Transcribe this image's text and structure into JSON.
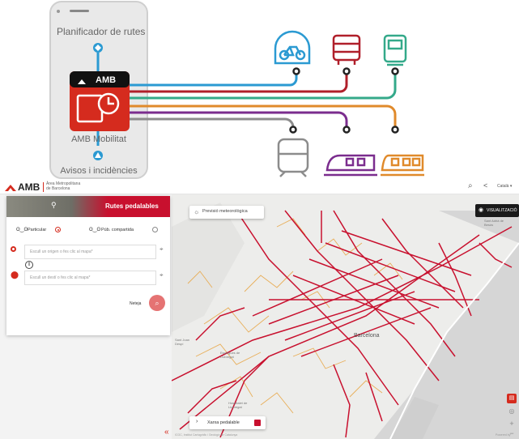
{
  "promo": {
    "phone_title": "Planificador de rutes",
    "amb_logo": "AMB",
    "app_name": "AMB Mobilitat",
    "alerts": "Avisos i incidències",
    "accent": "#d52b1e",
    "line_colors": [
      "#2b9ad2",
      "#b01f2a",
      "#34a98a",
      "#8c8c8c",
      "#7b2d8e",
      "#e08a2b"
    ]
  },
  "header": {
    "logo": "AMB",
    "org_line1": "Àrea Metropolitana",
    "org_line2": "de Barcelona",
    "language": "Català ▾"
  },
  "panel": {
    "banner_title": "Rutes pedalables",
    "mode_private": "Particular",
    "mode_shared": "Púb. compartida",
    "origin_placeholder": "Escull un origen o fes clic al mapa*",
    "destination_placeholder": "Escull un destí o fes clic al mapa*",
    "clear_label": "Neteja"
  },
  "map": {
    "weather_button": "Previsió meteorològica",
    "visualize_button": "VISUALITZACIÓ",
    "layer_toggle": "Xarxa pedalable",
    "city_label": "Barcelona",
    "labels": [
      "Sant Joan Despí",
      "Esplugues de Llobregat",
      "Hospitalet de Llobregat",
      "Sant Adrià de Besòs"
    ],
    "attribution": "ICGC, Institut Cartogràfic i Geològic de Catalunya",
    "powered": "Powered by",
    "collapse_icon": "«"
  }
}
